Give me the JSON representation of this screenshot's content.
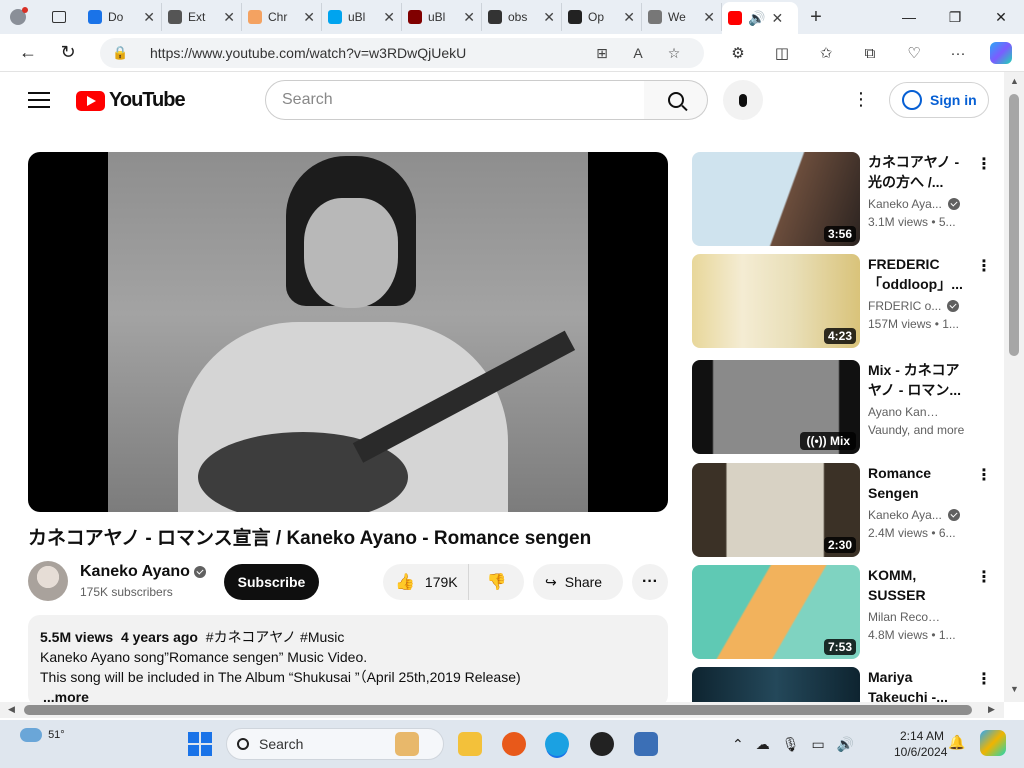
{
  "browser": {
    "tabs": [
      {
        "title": "Do",
        "color": "#1a73e8"
      },
      {
        "title": "Ext",
        "color": "#555555"
      },
      {
        "title": "Chr",
        "color": "#f4a261"
      },
      {
        "title": "uBl",
        "color": "#00a4ef"
      },
      {
        "title": "uBl",
        "color": "#800000"
      },
      {
        "title": "obs",
        "color": "#333333"
      },
      {
        "title": "Op",
        "color": "#222222"
      },
      {
        "title": "We",
        "color": "#777777"
      }
    ],
    "active_tab_icon": "youtube-icon",
    "url": "https://www.youtube.com/watch?v=w3RDwQjUekU",
    "new_tab_label": "+"
  },
  "yt": {
    "logo_text": "YouTube",
    "search_placeholder": "Search",
    "signin_label": "Sign in"
  },
  "video": {
    "title": "カネコアヤノ - ロマンス宣言 / Kaneko Ayano - Romance sengen",
    "channel": "Kaneko Ayano",
    "subscribers": "175K subscribers",
    "subscribe_label": "Subscribe",
    "likes": "179K",
    "share_label": "Share",
    "views": "5.5M views",
    "age": "4 years ago",
    "tags": "#カネコアヤノ #Music",
    "desc_line1": "Kaneko Ayano song”Romance sengen” Music Video.",
    "desc_line2": "This song will be included in The Album “Shukusai ”（April 25th,2019 Release)",
    "more_label": "...more"
  },
  "recommendations": [
    {
      "title": "カネコアヤノ - 光の方へ /...",
      "channel": "Kaneko Aya...",
      "stats": "3.1M views • 5...",
      "duration": "3:56",
      "verified": true
    },
    {
      "title": "FREDERIC 「oddloop」...",
      "channel": "FRDERIC o...",
      "stats": "157M views • 1...",
      "duration": "4:23",
      "verified": true
    },
    {
      "title": "Mix - カネコアヤノ - ロマン...",
      "channel": "Ayano Kaneko,",
      "stats": "Vaundy, and more",
      "duration": "Mix",
      "verified": false
    },
    {
      "title": "Romance Sengen",
      "channel": "Kaneko Aya...",
      "stats": "2.4M views • 6...",
      "duration": "2:30",
      "verified": true
    },
    {
      "title": "KOMM, SUSSER TOD...",
      "channel": "Milan Records U...",
      "stats": "4.8M views • 1...",
      "duration": "7:53",
      "verified": false
    },
    {
      "title": "Mariya Takeuchi -...",
      "channel": "",
      "stats": "",
      "duration": "",
      "verified": false
    }
  ],
  "taskbar": {
    "temperature": "51°",
    "search_label": "Search",
    "time": "2:14 AM",
    "date": "10/6/2024"
  }
}
